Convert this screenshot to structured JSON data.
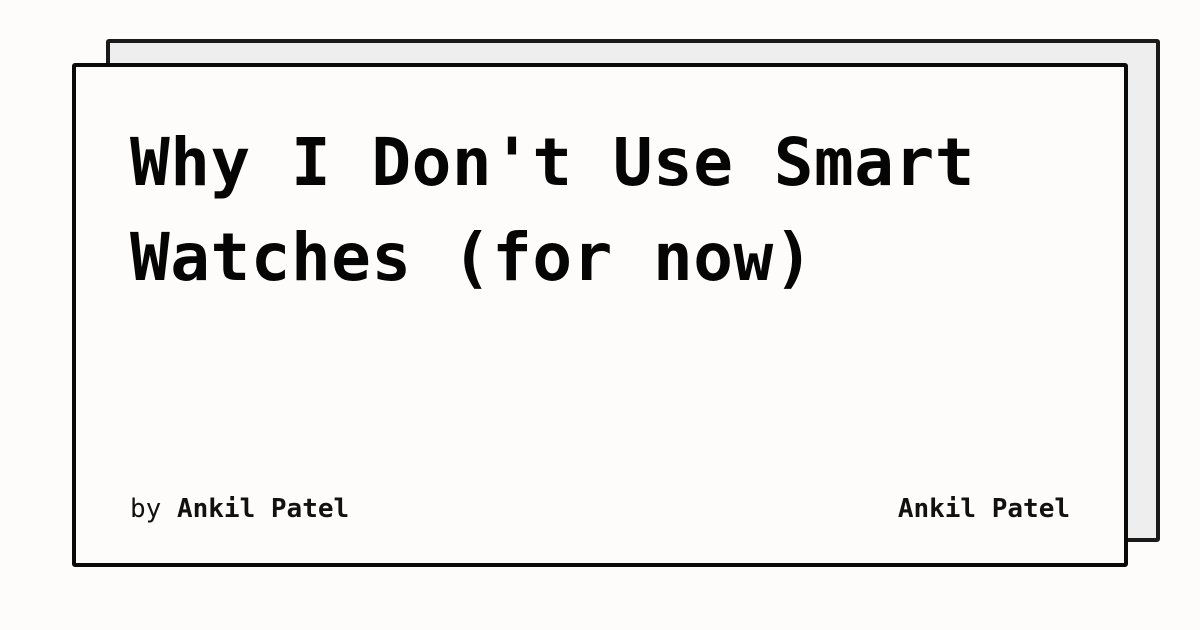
{
  "post": {
    "title": "Why I Don't Use Smart Watches (for now)",
    "byline_prefix": "by",
    "author": "Ankil Patel"
  },
  "site": {
    "name": "Ankil Patel"
  },
  "colors": {
    "background": "#fdfcfa",
    "card_back": "#eeeeee",
    "border": "#0a0a0a",
    "text": "#050505"
  }
}
